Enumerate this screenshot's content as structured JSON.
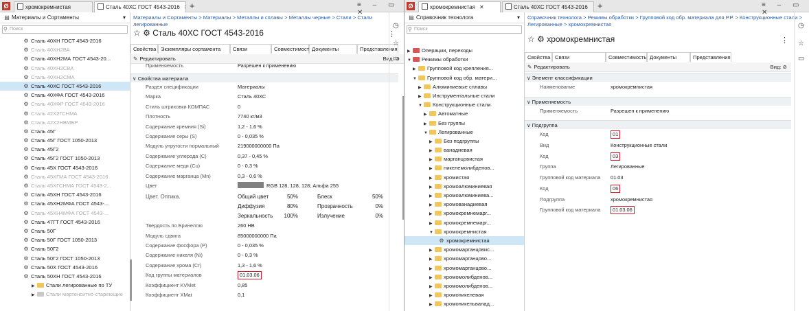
{
  "left": {
    "tabs": [
      "хромокремнистая",
      "Сталь 40ХС ГОСТ 4543-2016"
    ],
    "nav_title": "Материалы и Сортаменты",
    "search_placeholder": "Поиск",
    "tree": [
      {
        "label": "Сталь 40ХН ГОСТ 4543-2016",
        "dim": false
      },
      {
        "label": "Сталь 40ХН2ВА",
        "dim": true
      },
      {
        "label": "Сталь 40ХН2МА ГОСТ 4543-20...",
        "dim": false
      },
      {
        "label": "Сталь 40ХН2СВА",
        "dim": true
      },
      {
        "label": "Сталь 40ХН2СМА",
        "dim": true
      },
      {
        "label": "Сталь 40ХС ГОСТ 4543-2016",
        "dim": false,
        "selected": true
      },
      {
        "label": "Сталь 40ХФА ГОСТ 4543-2016",
        "dim": false
      },
      {
        "label": "Сталь 40ХФР ГОСТ 4543-2016",
        "dim": true
      },
      {
        "label": "Сталь 42Х2ГСНМА",
        "dim": true
      },
      {
        "label": "Сталь 42Х2НВМБР",
        "dim": true
      },
      {
        "label": "Сталь 45Г",
        "dim": false
      },
      {
        "label": "Сталь 45Г ГОСТ 1050-2013",
        "dim": false
      },
      {
        "label": "Сталь 45Г2",
        "dim": false
      },
      {
        "label": "Сталь 45Г2 ГОСТ 1050-2013",
        "dim": false
      },
      {
        "label": "Сталь 45Х ГОСТ 4543-2016",
        "dim": false
      },
      {
        "label": "Сталь 45ХГМА ГОСТ 4543-2016",
        "dim": true
      },
      {
        "label": "Сталь 45ХГСНМА ГОСТ 4543-2...",
        "dim": true
      },
      {
        "label": "Сталь 45ХН ГОСТ 4543-2016",
        "dim": false
      },
      {
        "label": "Сталь 45ХН2МФА ГОСТ 4543-...",
        "dim": false
      },
      {
        "label": "Сталь 45ХН4МФА ГОСТ 4543-...",
        "dim": true
      },
      {
        "label": "Сталь 47ГТ ГОСТ 4543-2016",
        "dim": false
      },
      {
        "label": "Сталь 50Г",
        "dim": false
      },
      {
        "label": "Сталь 50Г ГОСТ 1050-2013",
        "dim": false
      },
      {
        "label": "Сталь 50Г2",
        "dim": false
      },
      {
        "label": "Сталь 50Г2 ГОСТ 1050-2013",
        "dim": false
      },
      {
        "label": "Сталь 50Х ГОСТ 4543-2016",
        "dim": false
      },
      {
        "label": "Сталь 50ХН ГОСТ 4543-2016",
        "dim": false
      }
    ],
    "tree_folders": [
      {
        "label": "Стали легированные по ТУ",
        "dim": false
      },
      {
        "label": "Стали мартенситно-стареющие",
        "dim": true
      }
    ],
    "breadcrumb": "Материалы и Сортаменты > Материалы > Металлы и сплавы > Металлы черные > Стали > Стали легированные",
    "title": "Сталь 40ХС ГОСТ 4543-2016",
    "prop_tabs": [
      "Свойства",
      "Экземпляры сортамента",
      "Связи",
      "Совместимость",
      "Документы",
      "Представления"
    ],
    "edit_label": "Редактировать",
    "view_label": "Вид:",
    "cut_row": {
      "label": "Применяемость",
      "value": "Разрешен к применению"
    },
    "section": "Свойства материала",
    "rows": [
      {
        "label": "Раздел спецификации",
        "value": "Материалы"
      },
      {
        "label": "Марка",
        "value": "Сталь 40ХС"
      },
      {
        "label": "Стиль штриховки КОМПАС",
        "value": "0"
      },
      {
        "label": "Плотность",
        "value": "7740  кг/м3"
      },
      {
        "label": "Содержание кремния (Si)",
        "value": "1,2 - 1,6  %"
      },
      {
        "label": "Содержание серы (S)",
        "value": "0 - 0,035  %"
      },
      {
        "label": "Модуль упругости нормальный",
        "value": "219000000000  Па"
      },
      {
        "label": "Содержание углерода (C)",
        "value": "0,37 - 0,45  %"
      },
      {
        "label": "Содержание меди (Cu)",
        "value": "0 - 0,3  %"
      },
      {
        "label": "Содержание марганца (Mn)",
        "value": "0,3 - 0,6  %"
      },
      {
        "label": "Цвет",
        "value": "RGB 128, 128, 128; Альфа 255"
      }
    ],
    "optics": {
      "label": "Цвет. Оптика.",
      "grid": [
        [
          "Общий цвет",
          "50%",
          "Блеск",
          "50%"
        ],
        [
          "Диффузия",
          "80%",
          "Прозрачность",
          "0%"
        ],
        [
          "Зеркальность",
          "100%",
          "Излучение",
          "0%"
        ]
      ]
    },
    "rows2": [
      {
        "label": "Твердость по Бринеллю",
        "value": "260  HB"
      },
      {
        "label": "Модуль сдвига",
        "value": "85000000000  Па"
      },
      {
        "label": "Содержание фосфора (P)",
        "value": "0 - 0,035  %"
      },
      {
        "label": "Содержание никеля (Ni)",
        "value": "0 - 0,3  %"
      },
      {
        "label": "Содержание хрома (Cr)",
        "value": "1,3 - 1,6  %"
      },
      {
        "label": "Код группы материалов",
        "value": "01.03.06",
        "highlight": true
      },
      {
        "label": "Коэффициент KVMet",
        "value": "0,85"
      },
      {
        "label": "Коэффициент XMat",
        "value": "0,1"
      }
    ]
  },
  "right": {
    "tabs": [
      "хромокремнистая",
      "Сталь 40ХС ГОСТ 4543-2016"
    ],
    "nav_title": "Справочник технолога",
    "search_placeholder": "Поиск",
    "tree": [
      {
        "label": "Операции, переходы",
        "depth": 0,
        "icon": "red",
        "tri": "▶"
      },
      {
        "label": "Режимы обработки",
        "depth": 0,
        "icon": "red",
        "tri": "▼"
      },
      {
        "label": "Групповой код крепления...",
        "depth": 1,
        "icon": "yellow",
        "tri": "▶"
      },
      {
        "label": "Групповой код обр. матери...",
        "depth": 1,
        "icon": "yellow",
        "tri": "▼"
      },
      {
        "label": "Алюминиевые сплавы",
        "depth": 2,
        "icon": "yellow",
        "tri": "▶"
      },
      {
        "label": "Инструментальные стали",
        "depth": 2,
        "icon": "yellow",
        "tri": "▶"
      },
      {
        "label": "Конструкционные стали",
        "depth": 2,
        "icon": "yellow",
        "tri": "▼"
      },
      {
        "label": "Автоматные",
        "depth": 3,
        "icon": "yellow",
        "tri": "▶"
      },
      {
        "label": "Без группы",
        "depth": 3,
        "icon": "yellow",
        "tri": "▶"
      },
      {
        "label": "Легированные",
        "depth": 3,
        "icon": "yellow",
        "tri": "▼"
      },
      {
        "label": "Без подгруппы",
        "depth": 4,
        "icon": "yellow",
        "tri": "▶"
      },
      {
        "label": "ванадиевая",
        "depth": 4,
        "icon": "yellow",
        "tri": "▶"
      },
      {
        "label": "марганцовистая",
        "depth": 4,
        "icon": "yellow",
        "tri": "▶"
      },
      {
        "label": "никелемолибденов...",
        "depth": 4,
        "icon": "yellow",
        "tri": "▶"
      },
      {
        "label": "хромистая",
        "depth": 4,
        "icon": "yellow",
        "tri": "▶"
      },
      {
        "label": "хромоалюминиевая",
        "depth": 4,
        "icon": "yellow",
        "tri": "▶"
      },
      {
        "label": "хромоалюминиева...",
        "depth": 4,
        "icon": "yellow",
        "tri": "▶"
      },
      {
        "label": "хромованадиевая",
        "depth": 4,
        "icon": "yellow",
        "tri": "▶"
      },
      {
        "label": "хромокремнемарг...",
        "depth": 4,
        "icon": "yellow",
        "tri": "▶"
      },
      {
        "label": "хромокремнемарг...",
        "depth": 4,
        "icon": "yellow",
        "tri": "▶"
      },
      {
        "label": "хромокремнистая",
        "depth": 4,
        "icon": "yellow",
        "tri": "▼"
      },
      {
        "label": "хромокремнистая",
        "depth": 5,
        "icon": "gear",
        "tri": "",
        "selected": true
      },
      {
        "label": "хромомарганцовис...",
        "depth": 4,
        "icon": "yellow",
        "tri": "▶"
      },
      {
        "label": "хромомарганцово...",
        "depth": 4,
        "icon": "yellow",
        "tri": "▶"
      },
      {
        "label": "хромомарганцово...",
        "depth": 4,
        "icon": "yellow",
        "tri": "▶"
      },
      {
        "label": "хромомолибденов...",
        "depth": 4,
        "icon": "yellow",
        "tri": "▶"
      },
      {
        "label": "хромомолибденов...",
        "depth": 4,
        "icon": "yellow",
        "tri": "▶"
      },
      {
        "label": "хромоникелевая",
        "depth": 4,
        "icon": "yellow",
        "tri": "▶"
      },
      {
        "label": "хромоникельванад...",
        "depth": 4,
        "icon": "yellow",
        "tri": "▶"
      }
    ],
    "breadcrumb": "Справочник технолога > Режимы обработки > Групповой код обр. материала для Р.Р. > Конструкционные стали > Легированные > хромокремнистая",
    "title": "хромокремнистая",
    "prop_tabs": [
      "Свойства",
      "Связи",
      "Совместимость",
      "Документы",
      "Представления"
    ],
    "edit_label": "Редактировать",
    "view_label": "Вид:",
    "sections": [
      {
        "name": "Элемент классификации",
        "rows": [
          {
            "label": "Наименование",
            "value": "хромокремнистая"
          }
        ]
      },
      {
        "name": "Применяемость",
        "rows": [
          {
            "label": "Применяемость",
            "value": "Разрешен к применению"
          }
        ]
      },
      {
        "name": "Подгруппа",
        "rows": [
          {
            "label": "Код",
            "value": "01",
            "highlight": true
          },
          {
            "label": "Вид",
            "value": "Конструкционные стали"
          },
          {
            "label": "Код",
            "value": "03",
            "highlight": true
          },
          {
            "label": "Группа",
            "value": "Легированные"
          },
          {
            "label": "Групповой код материала",
            "value": "01.03"
          },
          {
            "label": "Код",
            "value": "06",
            "highlight": true
          },
          {
            "label": "Подгруппа",
            "value": "хромокремнистая"
          },
          {
            "label": "Групповой код материала",
            "value": "01.03.06",
            "highlight": true
          }
        ]
      }
    ]
  },
  "colors": {
    "link": "#2b5ca8",
    "highlight": "#d0162b",
    "selected": "#cfe6f7",
    "folder": "#f1c65a"
  }
}
